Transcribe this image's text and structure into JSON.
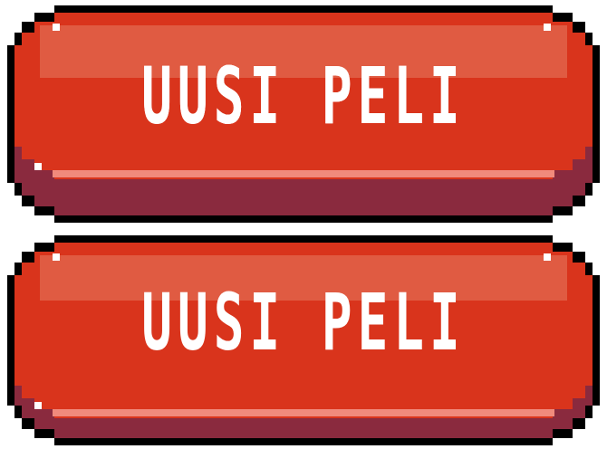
{
  "buttons": [
    {
      "label": "UUSI PELI",
      "state": "normal"
    },
    {
      "label": "UUSI PELI",
      "state": "pressed"
    }
  ],
  "colors": {
    "outline": "#000000",
    "face": "#d9341c",
    "highlight": "#e05b42",
    "rim": "#f08a7c",
    "shadow": "#8a2a3e",
    "text": "#ffffff"
  }
}
